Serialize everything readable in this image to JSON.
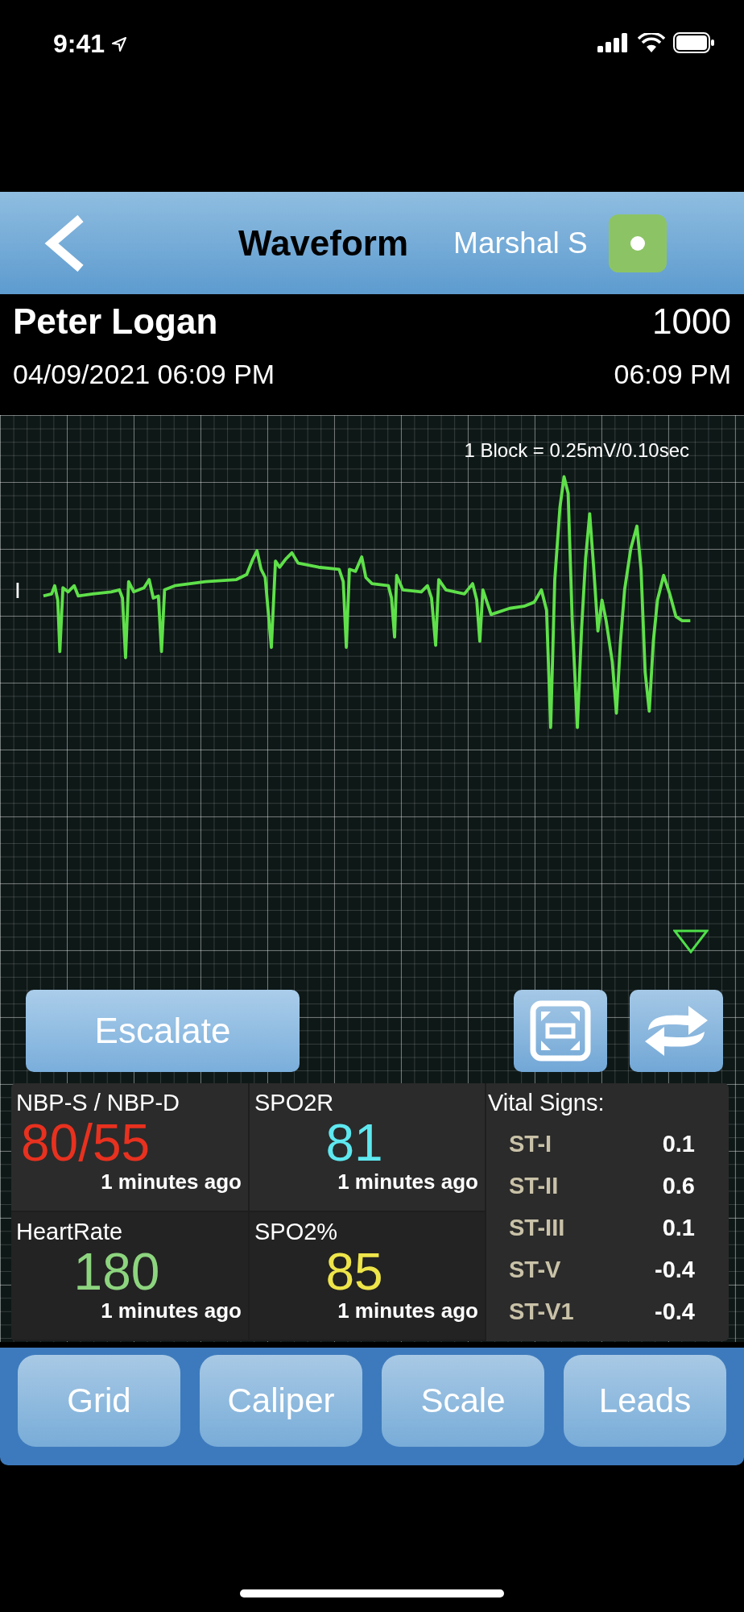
{
  "status_bar": {
    "time": "9:41"
  },
  "nav": {
    "title": "Waveform",
    "user": "Marshal S"
  },
  "patient": {
    "name": "Peter Logan",
    "id": "1000",
    "date": "04/09/2021 06:09 PM",
    "time": "06:09 PM"
  },
  "waveform": {
    "scale": "1 Block = 0.25mV/0.10sec",
    "lead": "I"
  },
  "actions": {
    "escalate": "Escalate"
  },
  "vitals": {
    "tiles": [
      {
        "label": "NBP-S / NBP-D",
        "value": "80/55",
        "color": "#e8311f",
        "updated": "1 minutes ago"
      },
      {
        "label": "SPO2R",
        "value": "81",
        "color": "#5ee8f0",
        "updated": "1 minutes ago"
      },
      {
        "label": "HeartRate",
        "value": "180",
        "color": "#8dd47f",
        "updated": "1 minutes ago"
      },
      {
        "label": "SPO2%",
        "value": "85",
        "color": "#eee54a",
        "updated": "1 minutes ago"
      }
    ],
    "title": "Vital Signs:",
    "st": [
      {
        "label": "ST-I",
        "value": "0.1"
      },
      {
        "label": "ST-II",
        "value": "0.6"
      },
      {
        "label": "ST-III",
        "value": "0.1"
      },
      {
        "label": "ST-V",
        "value": "-0.4"
      },
      {
        "label": "ST-V1",
        "value": "-0.4"
      }
    ]
  },
  "toolbar": [
    "Grid",
    "Caliper",
    "Scale",
    "Leads"
  ]
}
